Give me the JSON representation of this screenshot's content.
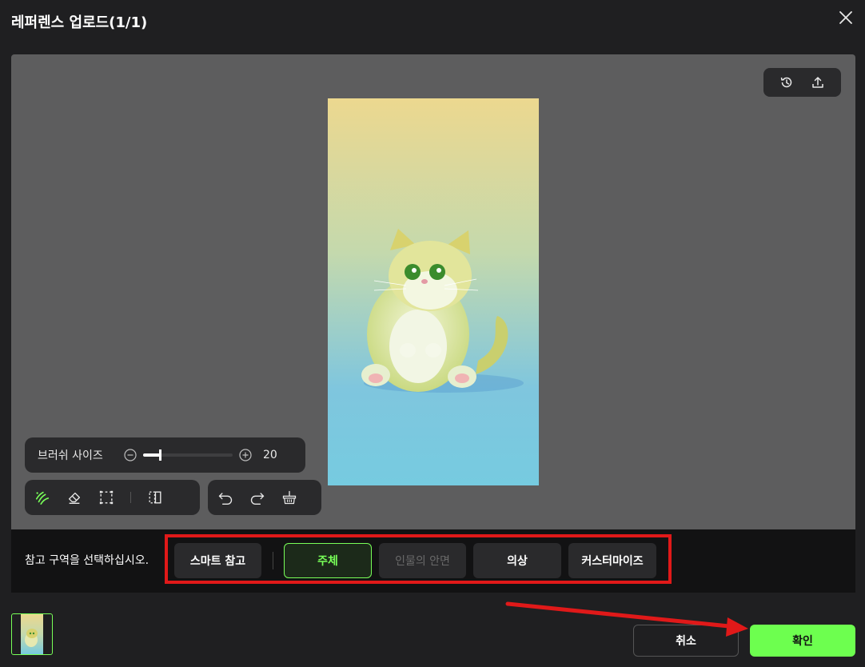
{
  "dialog": {
    "title": "레퍼렌스 업로드(1/1)"
  },
  "icons": {
    "close": "close-icon",
    "history": "history-icon",
    "upload": "upload-icon",
    "brush": "brush-icon",
    "eraser": "eraser-icon",
    "select": "select-icon",
    "invert": "invert-icon",
    "undo": "undo-icon",
    "redo": "redo-icon",
    "clear": "clear-basket-icon"
  },
  "brush": {
    "label": "브러쉬 사이즈",
    "value": "20",
    "level": 0.2
  },
  "region": {
    "prompt": "참고 구역을 선택하십시오.",
    "options": [
      {
        "label": "스마트 참고",
        "state": "normal"
      },
      {
        "label": "주체",
        "state": "active"
      },
      {
        "label": "인물의 안면",
        "state": "disabled"
      },
      {
        "label": "의상",
        "state": "normal"
      },
      {
        "label": "커스터마이즈",
        "state": "normal"
      }
    ]
  },
  "footer": {
    "cancel": "취소",
    "confirm": "확인"
  },
  "colors": {
    "accent": "#6dff4f",
    "annotation": "#e01919"
  }
}
